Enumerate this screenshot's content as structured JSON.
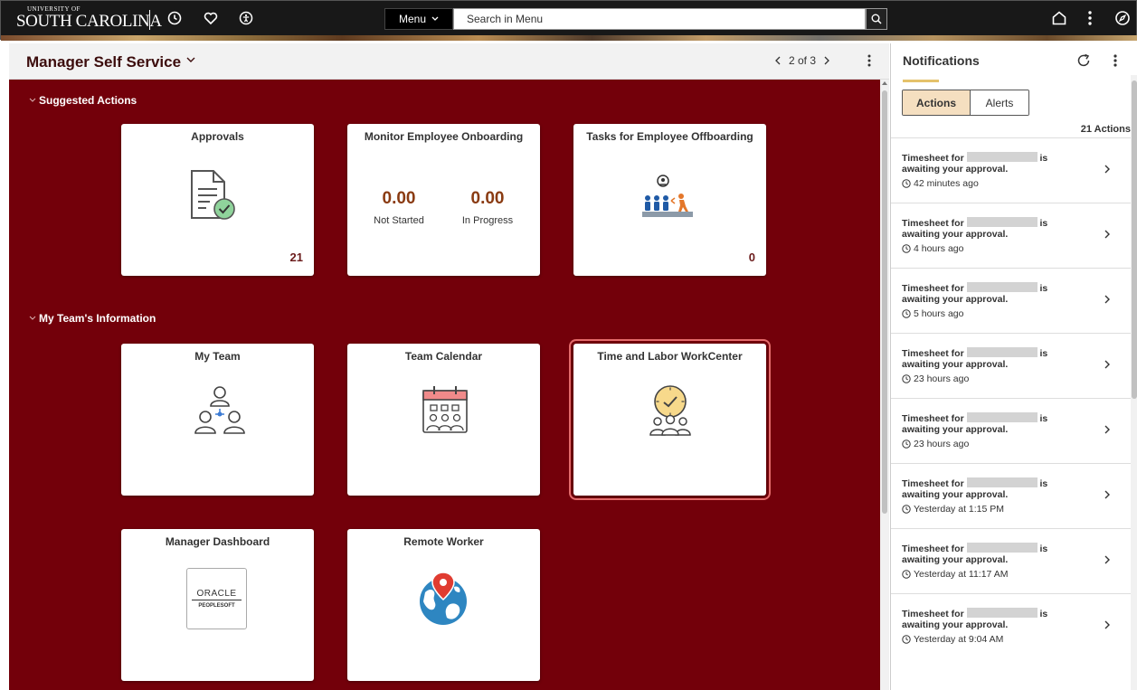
{
  "header": {
    "logo_top": "UNIVERSITY OF",
    "logo_main": "SOUTH CAROLINA",
    "icons": [
      "recent-icon",
      "favorites-icon",
      "accessibility-icon",
      "home-icon",
      "more-vert-icon",
      "navigator-icon"
    ],
    "menu_label": "Menu",
    "search_placeholder": "Search in Menu"
  },
  "page": {
    "title": "Manager Self Service",
    "pager": "2 of 3"
  },
  "sections": {
    "suggested": "Suggested Actions",
    "team": "My Team's Information"
  },
  "tiles": {
    "approvals": {
      "title": "Approvals",
      "count": "21"
    },
    "onboarding": {
      "title": "Monitor Employee Onboarding",
      "stat1_value": "0.00",
      "stat1_label": "Not Started",
      "stat2_value": "0.00",
      "stat2_label": "In Progress"
    },
    "offboarding": {
      "title": "Tasks for Employee Offboarding",
      "count": "0"
    },
    "my_team": {
      "title": "My Team"
    },
    "team_calendar": {
      "title": "Team Calendar"
    },
    "time_labor": {
      "title": "Time and Labor WorkCenter"
    },
    "manager_dashboard": {
      "title": "Manager Dashboard",
      "logo_line1": "ORACLE",
      "logo_line2": "PEOPLESOFT"
    },
    "remote_worker": {
      "title": "Remote Worker"
    }
  },
  "notifications": {
    "title": "Notifications",
    "tabs": [
      "Actions",
      "Alerts"
    ],
    "active_tab": "Actions",
    "count_label": "21 Actions",
    "items": [
      {
        "prefix": "Timesheet for",
        "suffix": "is",
        "line2": "awaiting your approval.",
        "time": "42 minutes ago"
      },
      {
        "prefix": "Timesheet for",
        "suffix": "is",
        "line2": "awaiting your approval.",
        "time": "4 hours ago"
      },
      {
        "prefix": "Timesheet for",
        "suffix": "is",
        "line2": "awaiting your approval.",
        "time": "5 hours ago"
      },
      {
        "prefix": "Timesheet for",
        "suffix": "is",
        "line2": "awaiting your approval.",
        "time": "23 hours ago"
      },
      {
        "prefix": "Timesheet for",
        "suffix": "is",
        "line2": "awaiting your approval.",
        "time": "23 hours ago"
      },
      {
        "prefix": "Timesheet for",
        "suffix": "is",
        "line2": "awaiting your approval.",
        "time": "Yesterday at 1:15 PM"
      },
      {
        "prefix": "Timesheet for",
        "suffix": "is",
        "line2": "awaiting your approval.",
        "time": "Yesterday at 11:17 AM"
      },
      {
        "prefix": "Timesheet for",
        "suffix": "is",
        "line2": "awaiting your approval.",
        "time": "Yesterday at 9:04 AM"
      }
    ]
  },
  "colors": {
    "canvas": "#73000a",
    "header": "#181818",
    "accent": "#e5c26b",
    "tile_focus": "#e36b6b"
  }
}
